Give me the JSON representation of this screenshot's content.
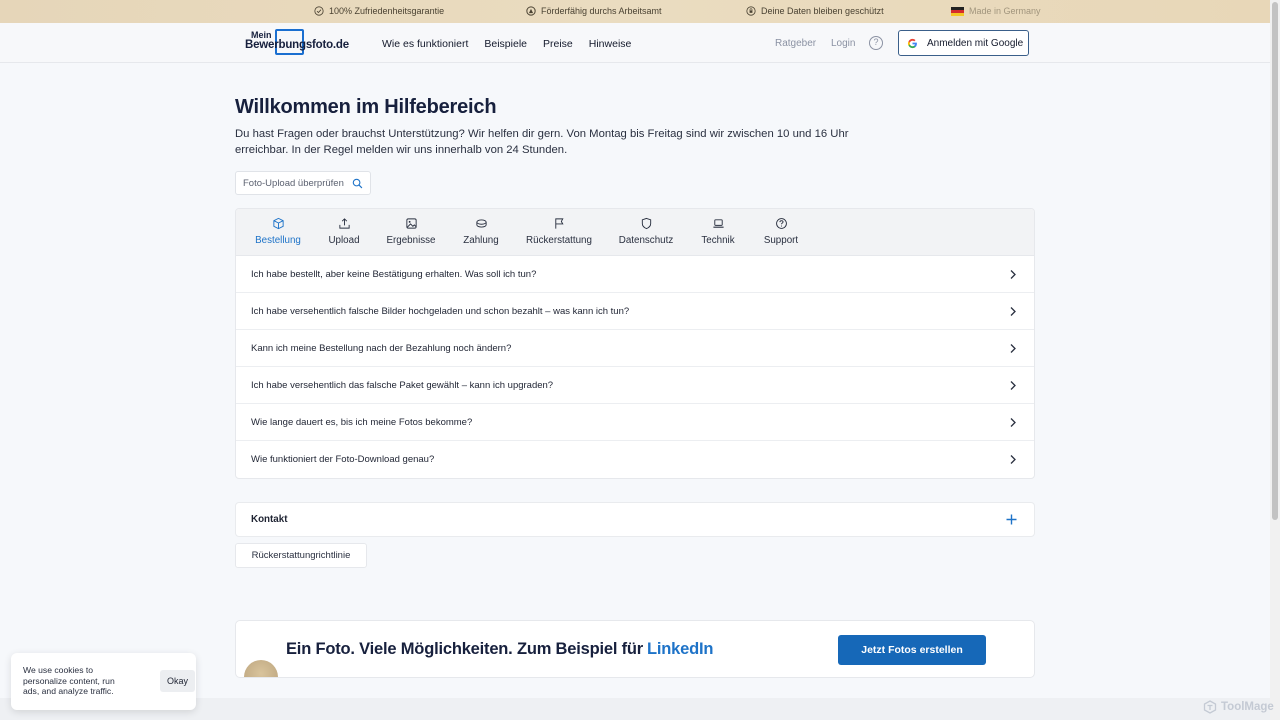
{
  "promo_bar": {
    "items": [
      "100% Zufriedenheitsgarantie",
      "Förderfähig durchs Arbeitsamt",
      "Deine Daten bleiben geschützt",
      "Made in Germany"
    ]
  },
  "header": {
    "logo_top": "Mein",
    "logo_main": "Bewerbungsfoto.de",
    "nav": [
      "Wie es funktioniert",
      "Beispiele",
      "Preise",
      "Hinweise"
    ],
    "ratgeber": "Ratgeber",
    "login": "Login",
    "help": "?",
    "google_button": "Anmelden mit Google"
  },
  "main": {
    "title": "Willkommen im Hilfebereich",
    "intro": "Du hast Fragen oder brauchst Unterstützung? Wir helfen dir gern. Von Montag bis Freitag sind wir zwischen 10 und 16 Uhr erreichbar. In der Regel melden wir uns innerhalb von 24 Stunden.",
    "search_placeholder": "Foto-Upload überprüfen"
  },
  "faq": {
    "tabs": [
      {
        "label": "Bestellung",
        "icon": "box-icon",
        "active": true
      },
      {
        "label": "Upload",
        "icon": "upload-icon"
      },
      {
        "label": "Ergebnisse",
        "icon": "image-icon"
      },
      {
        "label": "Zahlung",
        "icon": "coins-icon"
      },
      {
        "label": "Rückerstattung",
        "icon": "flag-icon"
      },
      {
        "label": "Datenschutz",
        "icon": "shield-icon"
      },
      {
        "label": "Technik",
        "icon": "laptop-icon"
      },
      {
        "label": "Support",
        "icon": "help-circle-icon"
      }
    ],
    "questions": [
      "Ich habe bestellt, aber keine Bestätigung erhalten. Was soll ich tun?",
      "Ich habe versehentlich falsche Bilder hochgeladen und schon bezahlt – was kann ich tun?",
      "Kann ich meine Bestellung nach der Bezahlung noch ändern?",
      "Ich habe versehentlich das falsche Paket gewählt – kann ich upgraden?",
      "Wie lange dauert es, bis ich meine Fotos bekomme?",
      "Wie funktioniert der Foto-Download genau?"
    ]
  },
  "kontakt": {
    "label": "Kontakt"
  },
  "refund_link": "Rückerstattungrichtlinie",
  "promo_card": {
    "headline": "Ein Foto. Viele Möglichkeiten. Zum Beispiel für",
    "accent_word": "LinkedIn",
    "cta": "Jetzt Fotos erstellen"
  },
  "cookie": {
    "text": "We use cookies to personalize content, run ads, and analyze traffic.",
    "button": "Okay"
  },
  "watermark": "ToolMage",
  "colors": {
    "accent": "#1e73c8",
    "cta": "#1668b8",
    "promo_bar": "#e8d8ba",
    "heading": "#17203d"
  }
}
